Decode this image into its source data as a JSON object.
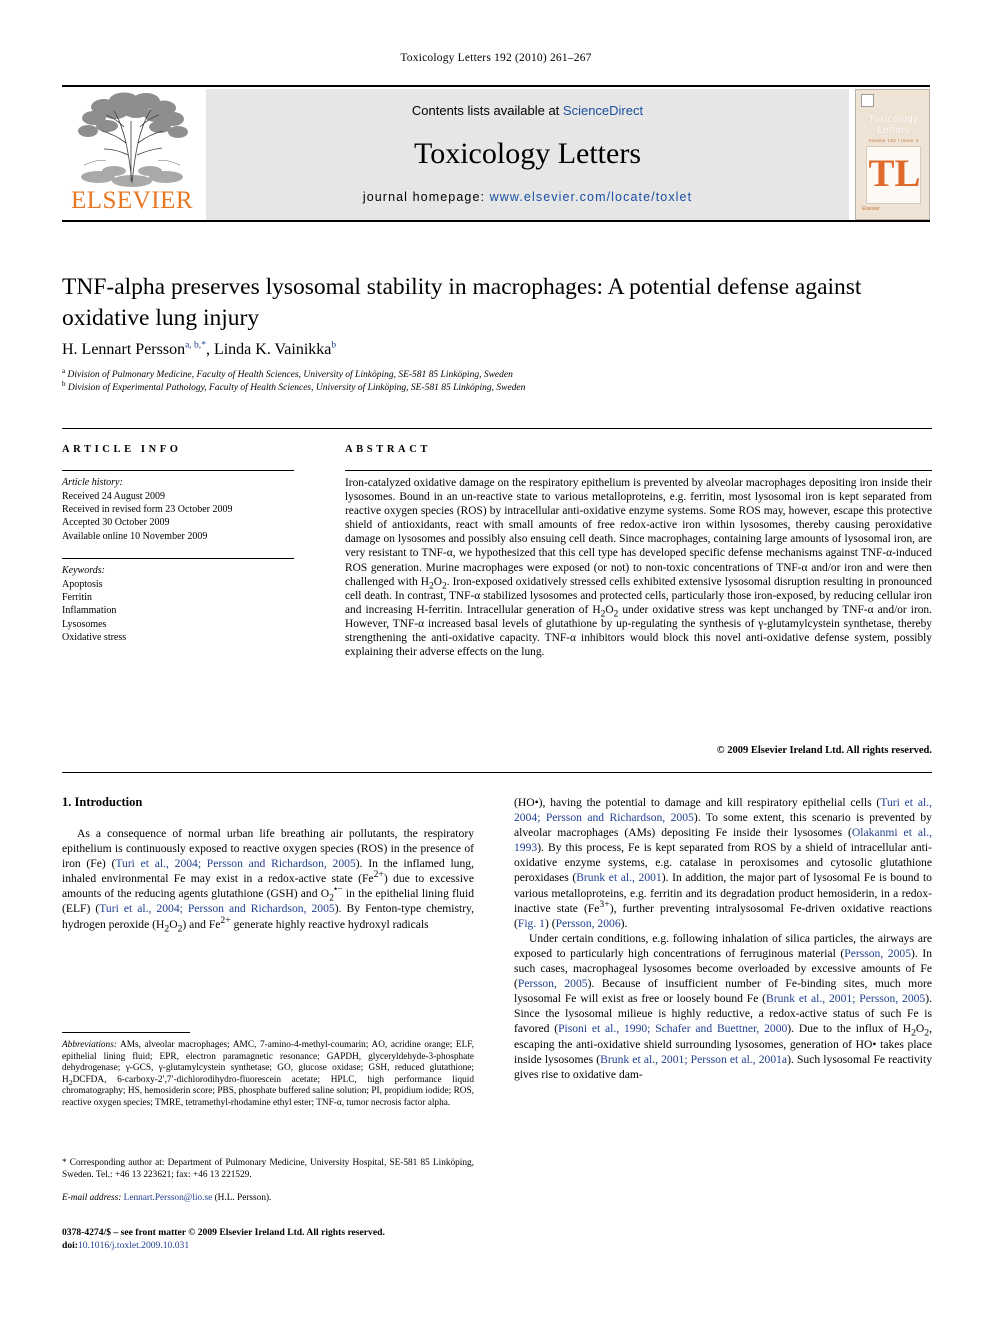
{
  "running_head": "Toxicology Letters 192 (2010) 261–267",
  "masthead": {
    "contents_prefix": "Contents lists available at ",
    "sciencedirect": "ScienceDirect",
    "journal_name": "Toxicology Letters",
    "homepage_label": "journal homepage: ",
    "homepage_url": "www.elsevier.com/locate/toxlet",
    "publisher": "ELSEVIER",
    "publisher_color": "#E87722",
    "link_color": "#1a4fa0",
    "cover": {
      "title_line1": "Toxicology",
      "title_line2": "Letters",
      "subtitle": "Volume 192 / Issue 3",
      "monogram": "TL",
      "footer": "Elsevier"
    }
  },
  "article": {
    "title": "TNF-alpha preserves lysosomal stability in macrophages: A potential defense against oxidative lung injury",
    "authors_part1": "H. Lennart Persson",
    "authors_sup1": "a, b,",
    "authors_star": "*",
    "authors_part2": ", Linda K. Vainikka",
    "authors_sup2": "b",
    "affiliation_a_sup": "a",
    "affiliation_a": "Division of Pulmonary Medicine, Faculty of Health Sciences, University of Linköping, SE-581 85 Linköping, Sweden",
    "affiliation_b_sup": "b",
    "affiliation_b": "Division of Experimental Pathology, Faculty of Health Sciences, University of Linköping, SE-581 85 Linköping, Sweden"
  },
  "info": {
    "heading": "ARTICLE INFO",
    "history_title": "Article history:",
    "history": [
      "Received 24 August 2009",
      "Received in revised form 23 October 2009",
      "Accepted 30 October 2009",
      "Available online 10 November 2009"
    ],
    "keywords_title": "Keywords:",
    "keywords": [
      "Apoptosis",
      "Ferritin",
      "Inflammation",
      "Lysosomes",
      "Oxidative stress"
    ]
  },
  "abstract": {
    "heading": "ABSTRACT",
    "text": "Iron-catalyzed oxidative damage on the respiratory epithelium is prevented by alveolar macrophages depositing iron inside their lysosomes. Bound in an un-reactive state to various metalloproteins, e.g. ferritin, most lysosomal iron is kept separated from reactive oxygen species (ROS) by intracellular anti-oxidative enzyme systems. Some ROS may, however, escape this protective shield of antioxidants, react with small amounts of free redox-active iron within lysosomes, thereby causing peroxidative damage on lysosomes and possibly also ensuing cell death. Since macrophages, containing large amounts of lysosomal iron, are very resistant to TNF-α, we hypothesized that this cell type has developed specific defense mechanisms against TNF-α-induced ROS generation. Murine macrophages were exposed (or not) to non-toxic concentrations of TNF-α and/or iron and were then challenged with H2O2. Iron-exposed oxidatively stressed cells exhibited extensive lysosomal disruption resulting in pronounced cell death. In contrast, TNF-α stabilized lysosomes and protected cells, particularly those iron-exposed, by reducing cellular iron and increasing H-ferritin. Intracellular generation of H2O2 under oxidative stress was kept unchanged by TNF-α and/or iron. However, TNF-α increased basal levels of glutathione by up-regulating the synthesis of γ-glutamylcystein synthetase, thereby strengthening the anti-oxidative capacity. TNF-α inhibitors would block this novel anti-oxidative defense system, possibly explaining their adverse effects on the lung.",
    "copyright": "© 2009 Elsevier Ireland Ltd. All rights reserved."
  },
  "body": {
    "section_title": "1. Introduction",
    "left_para": "As a consequence of normal urban life breathing air pollutants, the respiratory epithelium is continuously exposed to reactive oxygen species (ROS) in the presence of iron (Fe) (Turi et al., 2004; Persson and Richardson, 2005). In the inflamed lung, inhaled environmental Fe may exist in a redox-active state (Fe2+) due to excessive amounts of the reducing agents glutathione (GSH) and O2•− in the epithelial lining fluid (ELF) (Turi et al., 2004; Persson and Richardson, 2005). By Fenton-type chemistry, hydrogen peroxide (H2O2) and Fe2+ generate highly reactive hydroxyl radicals",
    "right_para1": "(HO•), having the potential to damage and kill respiratory epithelial cells (Turi et al., 2004; Persson and Richardson, 2005). To some extent, this scenario is prevented by alveolar macrophages (AMs) depositing Fe inside their lysosomes (Olakanmi et al., 1993). By this process, Fe is kept separated from ROS by a shield of intracellular anti-oxidative enzyme systems, e.g. catalase in peroxisomes and cytosolic glutathione peroxidases (Brunk et al., 2001). In addition, the major part of lysosomal Fe is bound to various metalloproteins, e.g. ferritin and its degradation product hemosiderin, in a redox-inactive state (Fe3+), further preventing intralysosomal Fe-driven oxidative reactions (Fig. 1) (Persson, 2006).",
    "right_para2": "Under certain conditions, e.g. following inhalation of silica particles, the airways are exposed to particularly high concentrations of ferruginous material (Persson, 2005). In such cases, macrophageal lysosomes become overloaded by excessive amounts of Fe (Persson, 2005). Because of insufficient number of Fe-binding sites, much more lysosomal Fe will exist as free or loosely bound Fe (Brunk et al., 2001; Persson, 2005). Since the lysosomal milieue is highly reductive, a redox-active status of such Fe is favored (Pisoni et al., 1990; Schafer and Buettner, 2000). Due to the influx of H2O2, escaping the anti-oxidative shield surrounding lysosomes, generation of HO• takes place inside lysosomes (Brunk et al., 2001; Persson et al., 2001a). Such lysosomal Fe reactivity gives rise to oxidative dam-"
  },
  "footnotes": {
    "abbrev_label": "Abbreviations:",
    "abbrev_text": " AMs, alveolar macrophages; AMC, 7-amino-4-methyl-coumarin; AO, acridine orange; ELF, epithelial lining fluid; EPR, electron paramagnetic resonance; GAPDH, glyceryldehyde-3-phosphate dehydrogenase; γ-GCS, γ-glutamylcystein synthetase; GO, glucose oxidase; GSH, reduced glutathione; H2DCFDA, 6-carboxy-2′,7′-dichlorodihydro-fluorescein acetate; HPLC, high performance liquid chromatography; HS, hemosiderin score; PBS, phosphate buffered saline solution; PI, propidium iodide; ROS, reactive oxygen species; TMRE, tetramethyl-rhodamine ethyl ester; TNF-α, tumor necrosis factor alpha.",
    "corresponding_star": "*",
    "corresponding": " Corresponding author at: Department of Pulmonary Medicine, University Hospital, SE-581 85 Linköping, Sweden. Tel.: +46 13 223621; fax: +46 13 221529.",
    "email_label": "E-mail address:",
    "email": "Lennart.Persson@lio.se",
    "email_suffix": " (H.L. Persson).",
    "imprint": "0378-4274/$ – see front matter © 2009 Elsevier Ireland Ltd. All rights reserved.",
    "doi_label": "doi:",
    "doi": "10.1016/j.toxlet.2009.10.031"
  }
}
